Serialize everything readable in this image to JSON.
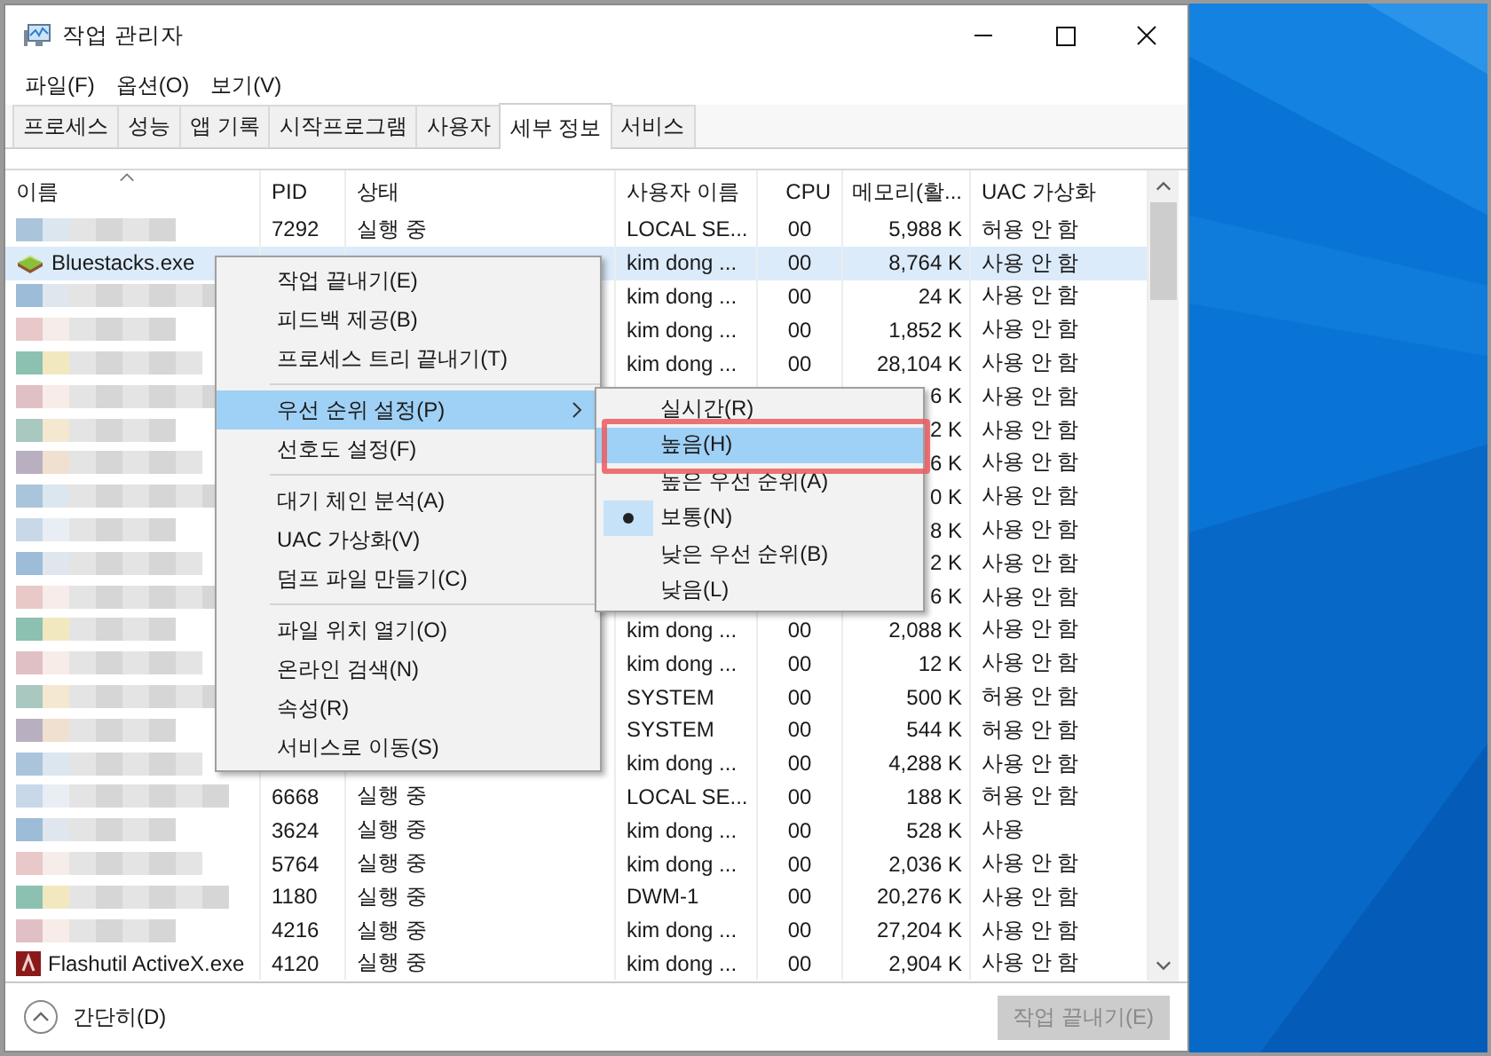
{
  "window": {
    "title": "작업 관리자"
  },
  "menu_bar": [
    "파일(F)",
    "옵션(O)",
    "보기(V)"
  ],
  "tabs": [
    {
      "label": "프로세스",
      "selected": false
    },
    {
      "label": "성능",
      "selected": false
    },
    {
      "label": "앱 기록",
      "selected": false
    },
    {
      "label": "시작프로그램",
      "selected": false
    },
    {
      "label": "사용자",
      "selected": false
    },
    {
      "label": "세부 정보",
      "selected": true
    },
    {
      "label": "서비스",
      "selected": false
    }
  ],
  "table": {
    "columns": [
      {
        "label": "이름",
        "sorted": true
      },
      {
        "label": "PID"
      },
      {
        "label": "상태"
      },
      {
        "label": "사용자 이름"
      },
      {
        "label": "CPU"
      },
      {
        "label": "메모리(활..."
      },
      {
        "label": "UAC 가상화"
      }
    ],
    "rows": [
      {
        "kind": "blurred",
        "selected": false,
        "pid": "7292",
        "status": "실행 중",
        "user": "LOCAL SE...",
        "cpu": "00",
        "memory": "5,988 K",
        "uac": "허용 안 함"
      },
      {
        "kind": "stack",
        "name": "Bluestacks.exe",
        "selected": true,
        "user": "kim dong ...",
        "cpu": "00",
        "memory": "8,764 K",
        "uac": "사용 안 함"
      },
      {
        "kind": "blurred",
        "selected": false,
        "user": "kim dong ...",
        "cpu": "00",
        "memory": "24 K",
        "uac": "사용 안 함"
      },
      {
        "kind": "blurred",
        "selected": false,
        "user": "kim dong ...",
        "cpu": "00",
        "memory": "1,852 K",
        "uac": "사용 안 함"
      },
      {
        "kind": "blurred",
        "selected": false,
        "user": "kim dong ...",
        "cpu": "00",
        "memory": "28,104 K",
        "uac": "사용 안 함"
      },
      {
        "kind": "blurred",
        "selected": false,
        "memory": "6 K",
        "uac": "사용 안 함"
      },
      {
        "kind": "blurred",
        "selected": false,
        "memory": "2 K",
        "uac": "사용 안 함"
      },
      {
        "kind": "blurred",
        "selected": false,
        "memory": "6 K",
        "uac": "사용 안 함"
      },
      {
        "kind": "blurred",
        "selected": false,
        "memory": "0 K",
        "uac": "사용 안 함"
      },
      {
        "kind": "blurred",
        "selected": false,
        "memory": "8 K",
        "uac": "사용 안 함"
      },
      {
        "kind": "blurred",
        "selected": false,
        "memory": "2 K",
        "uac": "사용 안 함"
      },
      {
        "kind": "blurred",
        "selected": false,
        "memory": "6 K",
        "uac": "사용 안 함"
      },
      {
        "kind": "blurred",
        "selected": false,
        "user": "kim dong ...",
        "cpu": "00",
        "memory": "2,088 K",
        "uac": "사용 안 함"
      },
      {
        "kind": "blurred",
        "selected": false,
        "user": "kim dong ...",
        "cpu": "00",
        "memory": "12 K",
        "uac": "사용 안 함"
      },
      {
        "kind": "blurred",
        "selected": false,
        "user": "SYSTEM",
        "cpu": "00",
        "memory": "500 K",
        "uac": "허용 안 함"
      },
      {
        "kind": "blurred",
        "selected": false,
        "user": "SYSTEM",
        "cpu": "00",
        "memory": "544 K",
        "uac": "허용 안 함"
      },
      {
        "kind": "blurred",
        "selected": false,
        "user": "kim dong ...",
        "cpu": "00",
        "memory": "4,288 K",
        "uac": "사용 안 함"
      },
      {
        "kind": "blurred",
        "selected": false,
        "pid": "6668",
        "status": "실행 중",
        "user": "LOCAL SE...",
        "cpu": "00",
        "memory": "188 K",
        "uac": "허용 안 함"
      },
      {
        "kind": "blurred",
        "selected": false,
        "pid": "3624",
        "status": "실행 중",
        "user": "kim dong ...",
        "cpu": "00",
        "memory": "528 K",
        "uac": "사용"
      },
      {
        "kind": "blurred",
        "selected": false,
        "pid": "5764",
        "status": "실행 중",
        "user": "kim dong ...",
        "cpu": "00",
        "memory": "2,036 K",
        "uac": "사용 안 함"
      },
      {
        "kind": "blurred",
        "selected": false,
        "pid": "1180",
        "status": "실행 중",
        "user": "DWM-1",
        "cpu": "00",
        "memory": "20,276 K",
        "uac": "사용 안 함"
      },
      {
        "kind": "blurred",
        "selected": false,
        "pid": "4216",
        "status": "실행 중",
        "user": "kim dong ...",
        "cpu": "00",
        "memory": "27,204 K",
        "uac": "사용 안 함"
      },
      {
        "kind": "flash",
        "name": "Flashutil ActiveX.exe",
        "selected": false,
        "pid": "4120",
        "status": "실행 중",
        "user": "kim dong ...",
        "cpu": "00",
        "memory": "2,904 K",
        "uac": "사용 안 함"
      }
    ]
  },
  "context_menu": {
    "items": [
      {
        "kind": "item",
        "label": "작업 끝내기(E)",
        "highlighted": false
      },
      {
        "kind": "item",
        "label": "피드백 제공(B)",
        "highlighted": false
      },
      {
        "kind": "item",
        "label": "프로세스 트리 끝내기(T)",
        "highlighted": false
      },
      {
        "kind": "separator"
      },
      {
        "kind": "submenu",
        "label": "우선 순위 설정(P)",
        "highlighted": true
      },
      {
        "kind": "item",
        "label": "선호도 설정(F)",
        "highlighted": false
      },
      {
        "kind": "separator"
      },
      {
        "kind": "item",
        "label": "대기 체인 분석(A)",
        "highlighted": false
      },
      {
        "kind": "item",
        "label": "UAC 가상화(V)",
        "highlighted": false
      },
      {
        "kind": "item",
        "label": "덤프 파일 만들기(C)",
        "highlighted": false
      },
      {
        "kind": "separator"
      },
      {
        "kind": "item",
        "label": "파일 위치 열기(O)",
        "highlighted": false
      },
      {
        "kind": "item",
        "label": "온라인 검색(N)",
        "highlighted": false
      },
      {
        "kind": "item",
        "label": "속성(R)",
        "highlighted": false
      },
      {
        "kind": "item",
        "label": "서비스로 이동(S)",
        "highlighted": false
      }
    ]
  },
  "submenu": {
    "items": [
      {
        "label": "실시간(R)",
        "highlighted": false,
        "selected": false,
        "annotated": false
      },
      {
        "label": "높음(H)",
        "highlighted": true,
        "selected": false,
        "annotated": true
      },
      {
        "label": "높은 우선 순위(A)",
        "highlighted": false,
        "selected": false,
        "annotated": false
      },
      {
        "label": "보통(N)",
        "highlighted": false,
        "selected": true,
        "annotated": false
      },
      {
        "label": "낮은 우선 순위(B)",
        "highlighted": false,
        "selected": false,
        "annotated": false
      },
      {
        "label": "낮음(L)",
        "highlighted": false,
        "selected": false,
        "annotated": false
      }
    ]
  },
  "footer": {
    "toggle": "간단히(D)",
    "button": {
      "label": "작업 끝내기(E)",
      "disabled": true
    }
  }
}
